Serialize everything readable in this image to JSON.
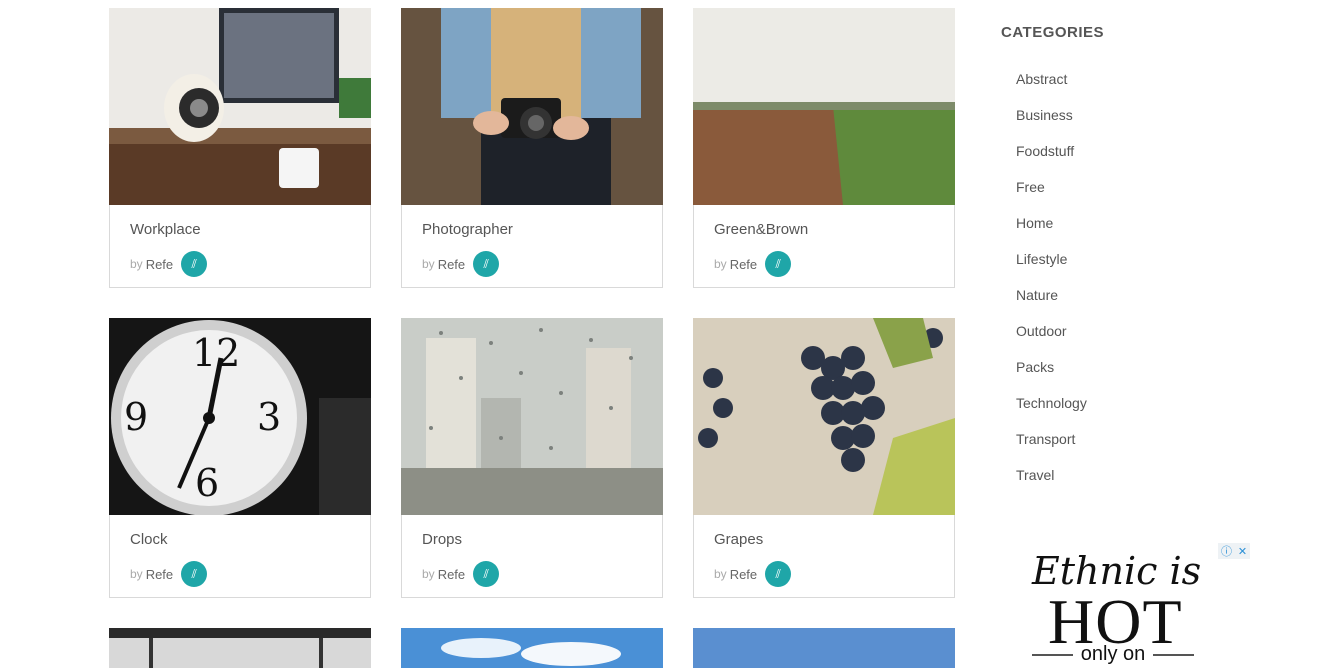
{
  "cards": [
    {
      "title": "Workplace",
      "by": "by",
      "author": "Refe"
    },
    {
      "title": "Photographer",
      "by": "by",
      "author": "Refe"
    },
    {
      "title": "Green&Brown",
      "by": "by",
      "author": "Refe"
    },
    {
      "title": "Clock",
      "by": "by",
      "author": "Refe"
    },
    {
      "title": "Drops",
      "by": "by",
      "author": "Refe"
    },
    {
      "title": "Grapes",
      "by": "by",
      "author": "Refe"
    }
  ],
  "sidebar": {
    "title": "CATEGORIES",
    "categories": [
      "Abstract",
      "Business",
      "Foodstuff",
      "Free",
      "Home",
      "Lifestyle",
      "Nature",
      "Outdoor",
      "Packs",
      "Technology",
      "Transport",
      "Travel"
    ]
  },
  "ad": {
    "line1": "Ethnic is",
    "line2": "HOT",
    "line3": "only on",
    "choices_icon": "info-icon",
    "close_icon": "close-icon"
  },
  "colors": {
    "accent": "#1fa6a8",
    "border": "#d9d9d9",
    "text": "#555555"
  }
}
